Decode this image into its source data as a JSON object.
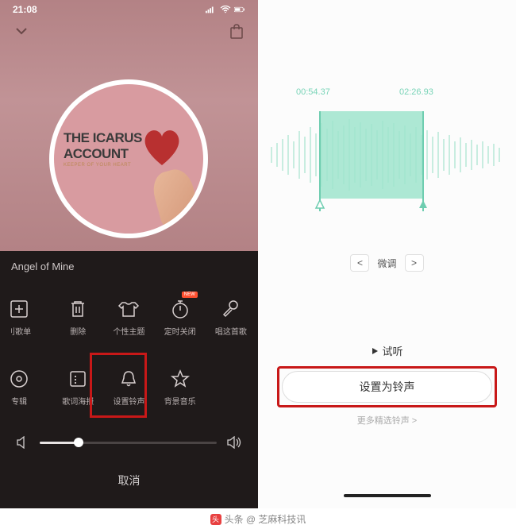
{
  "status": {
    "time": "21:08"
  },
  "album": {
    "title": "THE ICARUS ACCOUNT",
    "subtitle": "KEEPER OF YOUR HEART"
  },
  "song": {
    "title": "Angel of Mine"
  },
  "actions_row1": [
    {
      "key": "playlist",
      "label": "刂歌单"
    },
    {
      "key": "delete",
      "label": "删除"
    },
    {
      "key": "theme",
      "label": "个性主题"
    },
    {
      "key": "timer",
      "label": "定时关闭",
      "badge": "NEW"
    },
    {
      "key": "sing",
      "label": "唱这首歌"
    }
  ],
  "actions_row2": [
    {
      "key": "album",
      "label": "专辑"
    },
    {
      "key": "lyric",
      "label": "歌词海报"
    },
    {
      "key": "ringtone",
      "label": "设置铃声"
    },
    {
      "key": "bgm",
      "label": "背景音乐"
    }
  ],
  "cancel": "取消",
  "trim": {
    "start": "00:54.37",
    "end": "02:26.93",
    "fine_tune": "微调"
  },
  "preview_label": "试听",
  "set_ringtone": "设置为铃声",
  "more_ringtones": "更多精选铃声 >",
  "watermark": "头条 @ 芝麻科技讯"
}
